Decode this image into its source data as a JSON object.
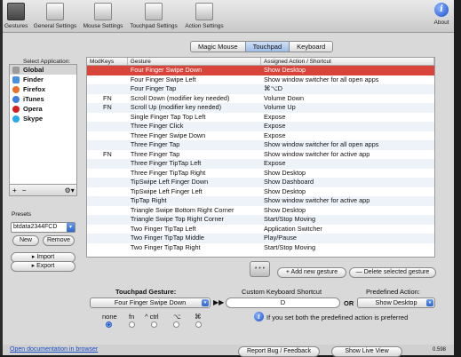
{
  "toolbar": {
    "items": [
      {
        "label": "Gestures"
      },
      {
        "label": "General Settings"
      },
      {
        "label": "Mouse Settings"
      },
      {
        "label": "Touchpad Settings"
      },
      {
        "label": "Action Settings"
      },
      {
        "label": "About"
      }
    ]
  },
  "tabs": [
    {
      "label": "Magic Mouse"
    },
    {
      "label": "Touchpad"
    },
    {
      "label": "Keyboard"
    }
  ],
  "sidebar": {
    "select_label": "Select Application:",
    "apps": [
      {
        "label": "Global",
        "color": "#9a9a9a"
      },
      {
        "label": "Finder",
        "color": "#4a8fe0"
      },
      {
        "label": "Firefox",
        "color": "#e8702a"
      },
      {
        "label": "iTunes",
        "color": "#3b7de0"
      },
      {
        "label": "Opera",
        "color": "#d21f1f"
      },
      {
        "label": "Skype",
        "color": "#2aa9e8"
      }
    ],
    "add": "+",
    "remove": "−",
    "gear": "⚙▾"
  },
  "presets": {
    "label": "Presets",
    "selected": "btdata2344FCD",
    "new_label": "New",
    "remove_label": "Remove",
    "import_label": "Import",
    "export_label": "Export"
  },
  "table": {
    "headers": [
      "ModKeys",
      "Gesture",
      "Assigned Action / Shortcut"
    ],
    "rows": [
      {
        "mod": "",
        "gesture": "Four Finger Swipe Down",
        "action": "Show Desktop",
        "selected": true
      },
      {
        "mod": "",
        "gesture": "Four Finger Swipe Left",
        "action": "Show window switcher for all open apps"
      },
      {
        "mod": "",
        "gesture": "Four Finger Tap",
        "action": "⌘⌥D"
      },
      {
        "mod": "FN",
        "gesture": "Scroll Down (modifier key needed)",
        "action": "Volume Down"
      },
      {
        "mod": "FN",
        "gesture": "Scroll Up (modifier key needed)",
        "action": "Volume Up"
      },
      {
        "mod": "",
        "gesture": "Single Finger Tap Top Left",
        "action": "Expose"
      },
      {
        "mod": "",
        "gesture": "Three Finger Click",
        "action": "Expose"
      },
      {
        "mod": "",
        "gesture": "Three Finger Swipe Down",
        "action": "Expose"
      },
      {
        "mod": "",
        "gesture": "Three Finger Tap",
        "action": "Show window switcher for all open apps"
      },
      {
        "mod": "FN",
        "gesture": "Three Finger Tap",
        "action": "Show window switcher for active app"
      },
      {
        "mod": "",
        "gesture": "Three Finger TipTap Left",
        "action": "Expose"
      },
      {
        "mod": "",
        "gesture": "Three Finger TipTap Right",
        "action": "Show Desktop"
      },
      {
        "mod": "",
        "gesture": "TipSwipe Left Finger Down",
        "action": "Show Dashboard"
      },
      {
        "mod": "",
        "gesture": "TipSwipe Left Finger Left",
        "action": "Show Desktop"
      },
      {
        "mod": "",
        "gesture": "TipTap Right",
        "action": "Show window switcher for active app"
      },
      {
        "mod": "",
        "gesture": "Triangle Swipe Bottom Right Corner",
        "action": "Show Desktop"
      },
      {
        "mod": "",
        "gesture": "Triangle Swipe Top Right Corner",
        "action": "Start/Stop Moving"
      },
      {
        "mod": "",
        "gesture": "Two Finger TipTap Left",
        "action": "Application Switcher"
      },
      {
        "mod": "",
        "gesture": "Two Finger TipTap Middle",
        "action": "Play/Pause"
      },
      {
        "mod": "",
        "gesture": "Two Finger TipTap Right",
        "action": "Start/Stop Moving"
      }
    ]
  },
  "actions": {
    "add_gesture": "+ Add new gesture",
    "delete_gesture": "— Delete selected gesture"
  },
  "editor": {
    "touchpad_gesture_label": "Touchpad Gesture:",
    "gesture_value": "Four Finger Swipe Down",
    "arrow": "▶▶",
    "shortcut_label": "Custom Keyboard Shortcut",
    "shortcut_value": "D",
    "or_label": "OR",
    "predefined_label": "Predefined Action:",
    "predefined_value": "Show Desktop",
    "modifiers": [
      {
        "label": "none",
        "on": true
      },
      {
        "label": "fn",
        "on": false
      },
      {
        "label": "^ ctrl",
        "on": false
      },
      {
        "label": "⌥",
        "on": false
      },
      {
        "label": "⌘",
        "on": false
      }
    ],
    "note": "If you set both the predefined action is preferred"
  },
  "footer": {
    "doc_link": "Open documentation in browser",
    "report_bug": "Report Bug / Feedback",
    "live_view": "Show Live View",
    "version": "0.598"
  }
}
